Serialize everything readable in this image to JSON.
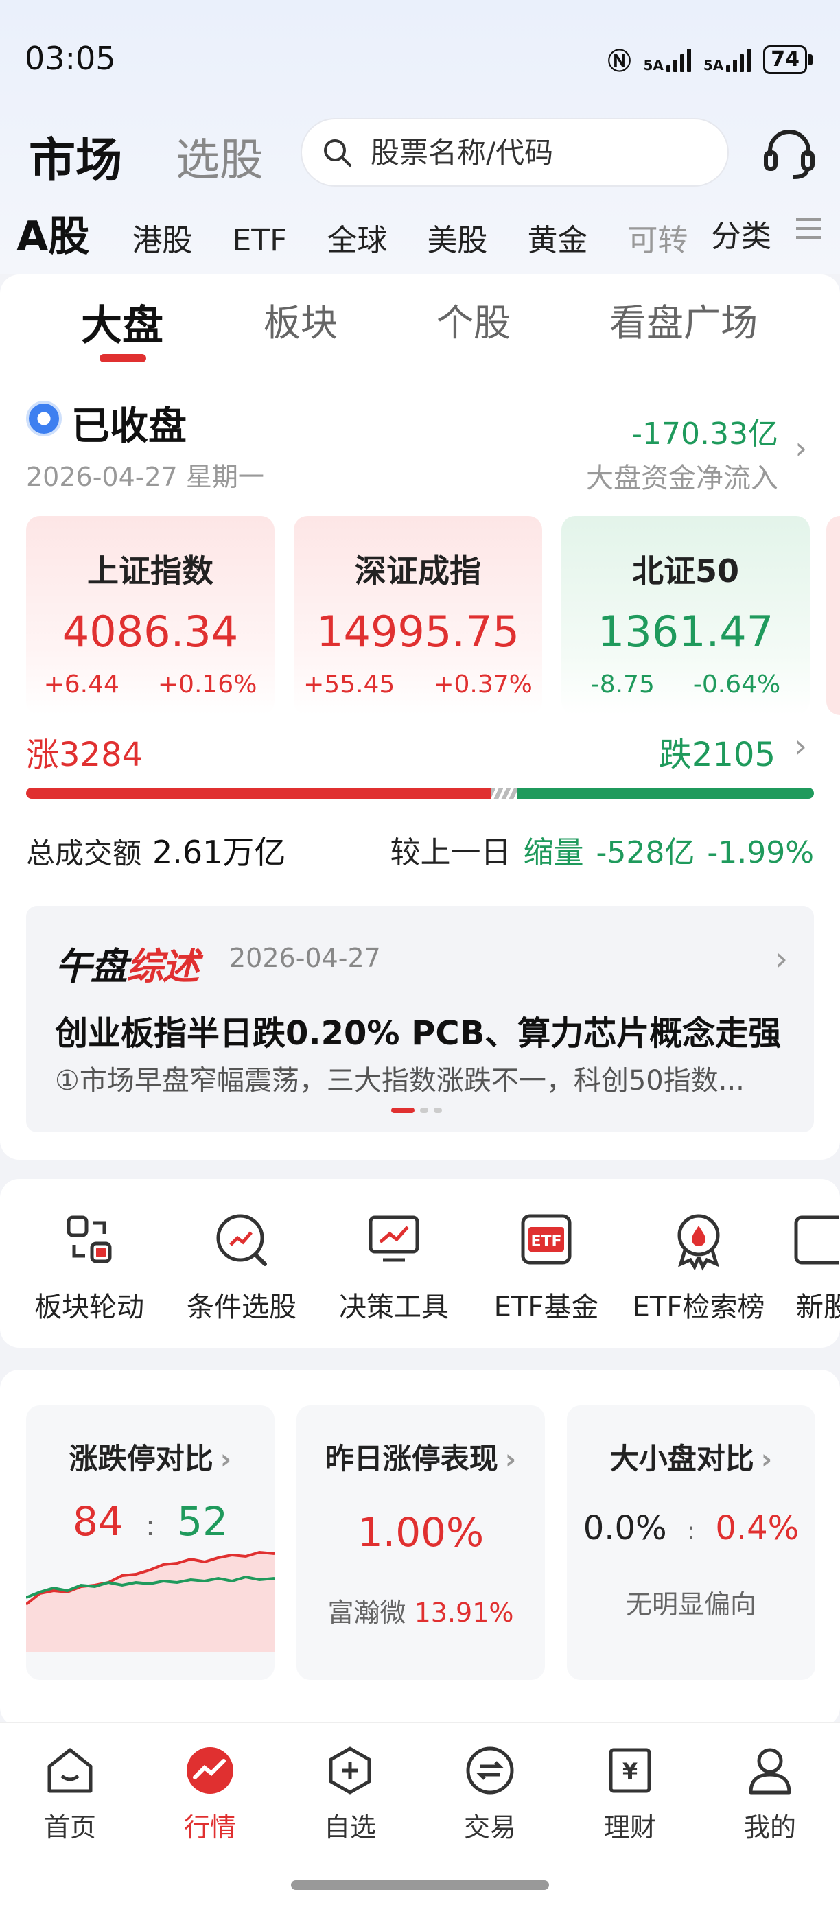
{
  "status_bar": {
    "time": "03:05",
    "signal1": "5A",
    "signal2": "5A",
    "battery": "74"
  },
  "header": {
    "title_active": "市场",
    "title_inactive": "选股",
    "search_placeholder": "股票名称/代码"
  },
  "market_tabs": [
    "A股",
    "港股",
    "ETF",
    "全球",
    "美股",
    "黄金",
    "可转",
    "分类"
  ],
  "sub_tabs": [
    "大盘",
    "板块",
    "个股",
    "看盘广场"
  ],
  "status": {
    "label": "已收盘",
    "date": "2026-04-27 星期一",
    "net_flow_value": "-170.33亿",
    "net_flow_label": "大盘资金净流入"
  },
  "indices": [
    {
      "name": "上证指数",
      "value": "4086.34",
      "change": "+6.44",
      "pct": "+0.16%",
      "trend": "up"
    },
    {
      "name": "深证成指",
      "value": "14995.75",
      "change": "+55.45",
      "pct": "+0.37%",
      "trend": "up"
    },
    {
      "name": "北证50",
      "value": "1361.47",
      "change": "-8.75",
      "pct": "-0.64%",
      "trend": "down"
    }
  ],
  "breadth": {
    "up": "涨3284",
    "down": "跌2105",
    "up_count": 3284,
    "down_count": 2105
  },
  "turnover": {
    "label": "总成交额",
    "value": "2.61万亿",
    "compare_label": "较上一日",
    "compare_state": "缩量",
    "compare_value": "-528亿",
    "compare_pct": "-1.99%"
  },
  "news": {
    "logo_a": "午盘",
    "logo_b": "综述",
    "date": "2026-04-27",
    "title": "创业板指半日跌0.20% PCB、算力芯片概念走强",
    "summary": "①市场早盘窄幅震荡，三大指数涨跌不一，科创50指数..."
  },
  "tools": [
    {
      "label": "板块轮动",
      "icon": "rotate-icon"
    },
    {
      "label": "条件选股",
      "icon": "filter-search-icon"
    },
    {
      "label": "决策工具",
      "icon": "chart-monitor-icon"
    },
    {
      "label": "ETF基金",
      "icon": "etf-icon"
    },
    {
      "label": "ETF检索榜",
      "icon": "award-icon"
    },
    {
      "label": "新股",
      "icon": "new-stock-icon"
    }
  ],
  "stats": {
    "limit": {
      "title": "涨跌停对比",
      "up": "84",
      "sep": ":",
      "down": "52"
    },
    "yesterday": {
      "title": "昨日涨停表现",
      "value": "1.00%",
      "stock": "富瀚微",
      "stock_pct": "13.91%"
    },
    "size": {
      "title": "大小盘对比",
      "left": "0.0%",
      "sep": ":",
      "right": "0.4%",
      "note": "无明显偏向"
    }
  },
  "bottom_nav": [
    {
      "label": "首页",
      "icon": "home-icon"
    },
    {
      "label": "行情",
      "icon": "market-icon",
      "active": true
    },
    {
      "label": "自选",
      "icon": "watchlist-icon"
    },
    {
      "label": "交易",
      "icon": "trade-icon"
    },
    {
      "label": "理财",
      "icon": "wealth-icon"
    },
    {
      "label": "我的",
      "icon": "profile-icon"
    }
  ],
  "colors": {
    "up": "#e03030",
    "down": "#1f9a5c",
    "accent": "#e03030"
  }
}
